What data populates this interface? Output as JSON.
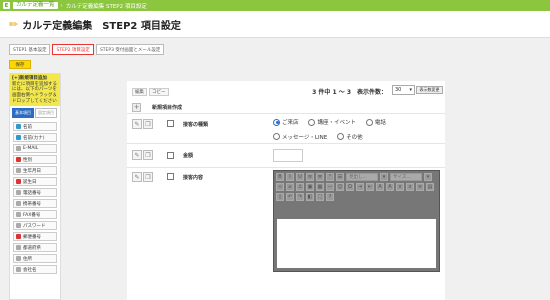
{
  "topbar": {
    "home_label": "E",
    "crumb_link": "カルテ定義一覧",
    "separator": "›",
    "crumb_current": "カルテ定義編集 STEP2 項目設定"
  },
  "header": {
    "title": "カルテ定義編集　STEP2 項目設定"
  },
  "steps": [
    {
      "label": "STEP1 基本設定"
    },
    {
      "label": "STEP2 項目設定"
    },
    {
      "label": "STEP3 受付画面とメール設定"
    }
  ],
  "save_button": "保存",
  "sidebar": {
    "head_title": "[+]新規項目追加",
    "head_text": "新たに項目を追加するには、以下のパーツを画面右側へドラッグ＆ドロップしてください",
    "tabs": [
      "基本項目",
      "固定項目"
    ],
    "items": [
      {
        "label": "名前",
        "icon": "user-icon"
      },
      {
        "label": "名前(カナ)",
        "icon": "user-kana-icon"
      },
      {
        "label": "E-MAIL",
        "icon": "mail-icon"
      },
      {
        "label": "性別",
        "icon": "gender-icon"
      },
      {
        "label": "生年月日",
        "icon": "birthday-icon"
      },
      {
        "label": "誕生日",
        "icon": "calendar-icon"
      },
      {
        "label": "電話番号",
        "icon": "phone-icon"
      },
      {
        "label": "携帯番号",
        "icon": "mobile-icon"
      },
      {
        "label": "FAX番号",
        "icon": "fax-icon"
      },
      {
        "label": "パスワード",
        "icon": "key-icon"
      },
      {
        "label": "郵便番号",
        "icon": "postal-icon"
      },
      {
        "label": "都道府県",
        "icon": "map-icon"
      },
      {
        "label": "住所",
        "icon": "house-icon"
      },
      {
        "label": "会社名",
        "icon": "company-icon"
      }
    ]
  },
  "main": {
    "edit_label": "編集",
    "copy_label": "コピー",
    "count_text": "3 件中 1 ～ 3　表示件数：",
    "per_page": "30",
    "per_page_button": "表示数変更",
    "new_item_label": "新規項目作成",
    "rows": [
      {
        "label": "接客の種類",
        "options": [
          "ご来店",
          "講座・イベント",
          "電話",
          "メッセージ・LINE",
          "その他"
        ],
        "selected_index": 0
      },
      {
        "label": "金額"
      },
      {
        "label": "接客内容"
      }
    ],
    "editor": {
      "format_placeholder": "見出し…",
      "size_placeholder": "サイズ…"
    }
  },
  "colors": {
    "topbar": "#8cc63f",
    "save": "#fcd700",
    "accent": "#2b6cc4",
    "step_active": "#e33333"
  }
}
